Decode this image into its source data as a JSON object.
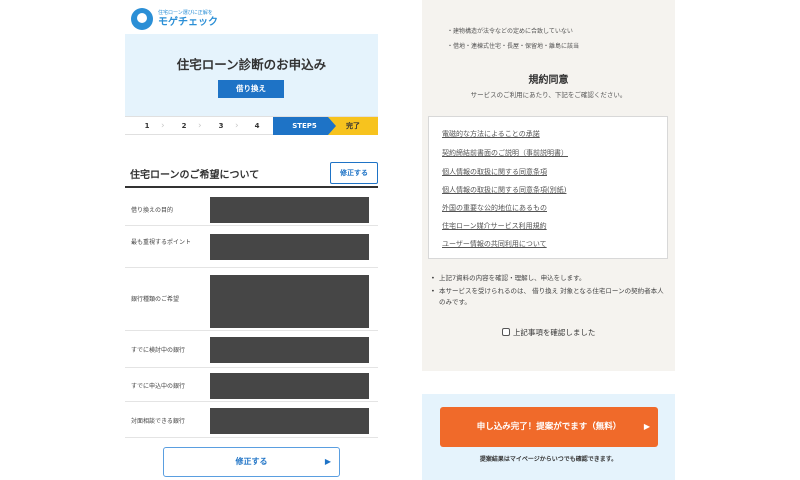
{
  "left": {
    "logo": {
      "tagline": "住宅ローン選びに正解を",
      "name": "モゲチェック"
    },
    "hero": {
      "title": "住宅ローン診断のお申込み",
      "button_label": "借り換え"
    },
    "steps": {
      "items": [
        "1",
        "2",
        "3",
        "4"
      ],
      "active": "STEP5",
      "done": "完了"
    },
    "section": {
      "title": "住宅ローンのご希望について",
      "edit_label": "修正する",
      "rows": [
        {
          "label": "借り換えの目的"
        },
        {
          "label": "最も重視するポイント"
        },
        {
          "label": "銀行種類のご希望"
        },
        {
          "label": "すでに検討中の銀行"
        },
        {
          "label": "すでに申込中の銀行"
        },
        {
          "label": "対面相談できる銀行"
        }
      ],
      "bottom_edit_label": "修正する"
    }
  },
  "right": {
    "top_bullets": [
      "・建物構造が法令などの定めに合致していない",
      "・借地・連棟式住宅・長屋・保留地・離島に該当"
    ],
    "agreement": {
      "title": "規約同意",
      "subtitle": "サービスのご利用にあたり、下記をご確認ください。",
      "links": [
        "電磁的な方法によることの承諾",
        "契約締結前書面のご説明（事前説明書）",
        "個人情報の取扱に関する同意条項",
        "個人情報の取扱に関する同意条項(別紙)",
        "外国の重要な公的地位にあるもの",
        "住宅ローン媒介サービス利用規約",
        "ユーザー情報の共同利用について"
      ],
      "notes": [
        "上記7資料の内容を確認・理解し、申込をします。",
        "本サービスを受けられるのは、 借り換え 対象となる住宅ローンの契約者本人のみです。"
      ],
      "checkbox_label": "上記事項を確認しました"
    },
    "cta": {
      "label": "申し込み完了！提案がでます（無料）",
      "note": "提案結果はマイページからいつでも確認できます。"
    }
  },
  "icons": {
    "arrow": "▶",
    "bullet": "•"
  },
  "colors": {
    "primary_blue": "#1e73c6",
    "step_yellow": "#f7c31e",
    "cta_orange": "#f06a2a",
    "hero_bg": "#e5f3fc",
    "masked_value": "#464646"
  }
}
